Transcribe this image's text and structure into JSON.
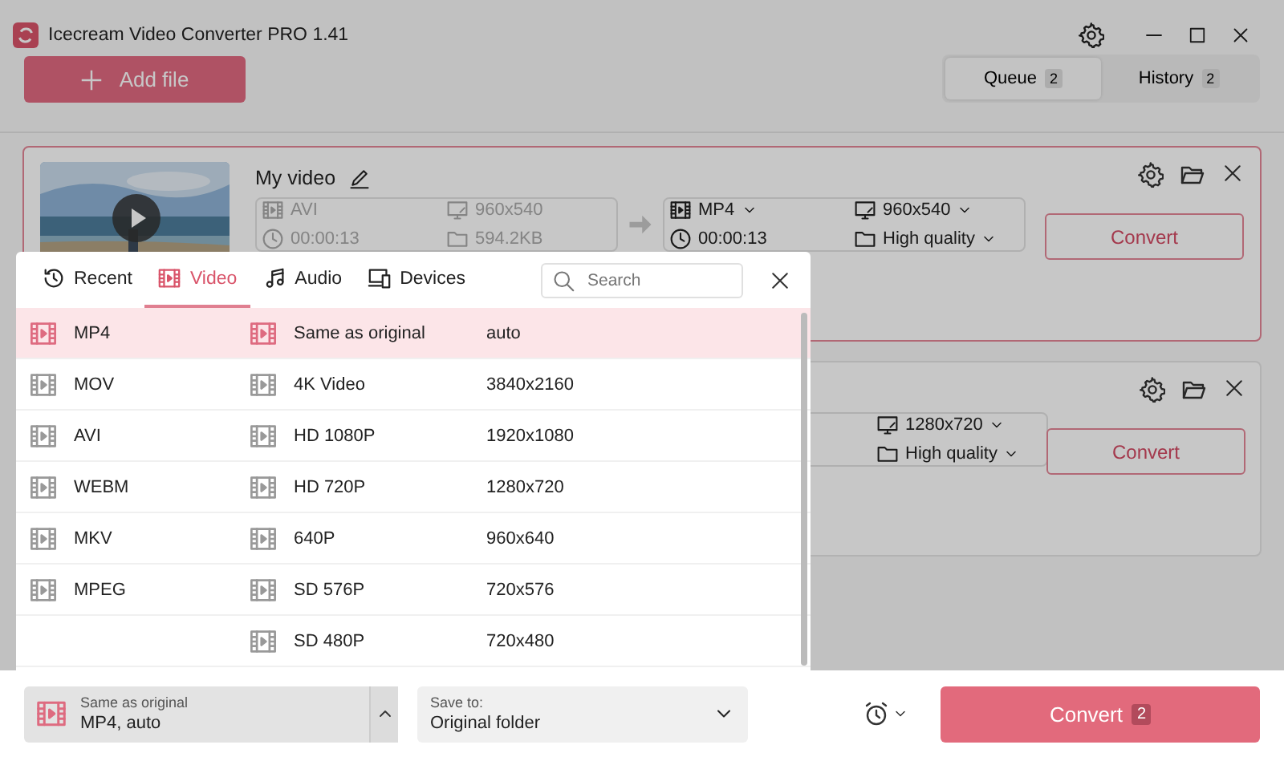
{
  "window": {
    "title": "Icecream Video Converter PRO 1.41"
  },
  "toolbar": {
    "add_button": "Add file",
    "tabs": [
      {
        "label": "Queue",
        "count": "2",
        "selected": true
      },
      {
        "label": "History",
        "count": "2",
        "selected": false
      }
    ]
  },
  "files": [
    {
      "name": "My video",
      "selected": true,
      "source": {
        "format": "AVI",
        "resolution": "960x540",
        "duration": "00:00:13",
        "size": "594.2KB"
      },
      "target": {
        "format": "MP4",
        "resolution": "960x540",
        "duration": "00:00:13",
        "quality": "High quality"
      },
      "convert": "Convert"
    },
    {
      "selected": false,
      "target": {
        "resolution": "1280x720",
        "quality": "High quality"
      },
      "convert": "Convert"
    }
  ],
  "format_popup": {
    "tabs": [
      {
        "label": "Recent",
        "kind": "recent",
        "selected": false
      },
      {
        "label": "Video",
        "kind": "video",
        "selected": true
      },
      {
        "label": "Audio",
        "kind": "audio",
        "selected": false
      },
      {
        "label": "Devices",
        "kind": "devices",
        "selected": false
      }
    ],
    "search": {
      "placeholder": "Search"
    },
    "rows": [
      {
        "format": "MP4",
        "preset": "Same as original",
        "resolution": "auto",
        "selected": true
      },
      {
        "format": "MOV",
        "preset": "4K Video",
        "resolution": "3840x2160",
        "selected": false
      },
      {
        "format": "AVI",
        "preset": "HD 1080P",
        "resolution": "1920x1080",
        "selected": false
      },
      {
        "format": "WEBM",
        "preset": "HD 720P",
        "resolution": "1280x720",
        "selected": false
      },
      {
        "format": "MKV",
        "preset": "640P",
        "resolution": "960x640",
        "selected": false
      },
      {
        "format": "MPEG",
        "preset": "SD 576P",
        "resolution": "720x576",
        "selected": false
      },
      {
        "preset": "SD 480P",
        "resolution": "720x480",
        "selected": false
      }
    ]
  },
  "bottom_bar": {
    "format": {
      "label": "Same as original",
      "value": "MP4, auto"
    },
    "save_to": {
      "label": "Save to:",
      "value": "Original folder"
    },
    "convert": {
      "label": "Convert",
      "count": "2"
    }
  }
}
